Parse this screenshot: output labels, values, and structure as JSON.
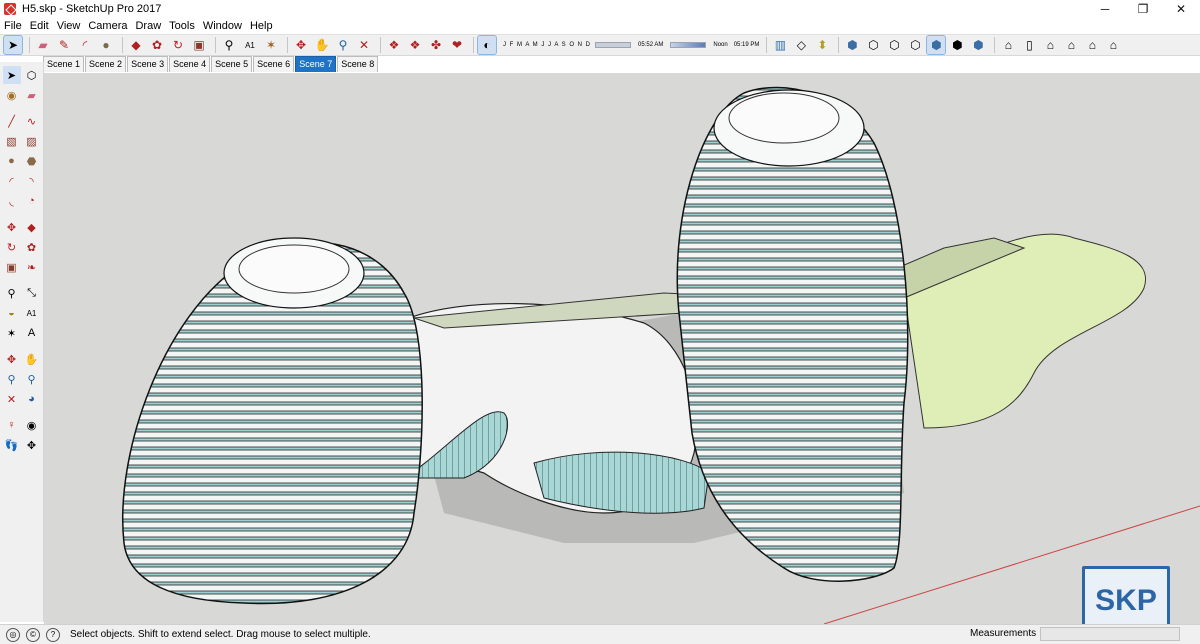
{
  "window": {
    "title": "H5.skp - SketchUp Pro 2017",
    "minimize": "─",
    "maximize": "❐",
    "close": "✕"
  },
  "menu": [
    "File",
    "Edit",
    "View",
    "Camera",
    "Draw",
    "Tools",
    "Window",
    "Help"
  ],
  "toolbar": {
    "months": "J F M A M J J A S O N D",
    "time_start": "05:52 AM",
    "time_noon": "Noon",
    "time_end": "05:19 PM"
  },
  "scenes": [
    "Scene 1",
    "Scene 2",
    "Scene 3",
    "Scene 4",
    "Scene 5",
    "Scene 6",
    "Scene 7",
    "Scene 8"
  ],
  "active_scene": "Scene 7",
  "status": {
    "message": "Select objects. Shift to extend select. Drag mouse to select multiple.",
    "measurements_label": "Measurements",
    "measurements_value": ""
  },
  "watermark": "SKP",
  "colors": {
    "viewport": "#d8d8d6",
    "glass": "#a9d7d6",
    "landscape": "#dfeeb6",
    "active_tab": "#1f73c6"
  }
}
